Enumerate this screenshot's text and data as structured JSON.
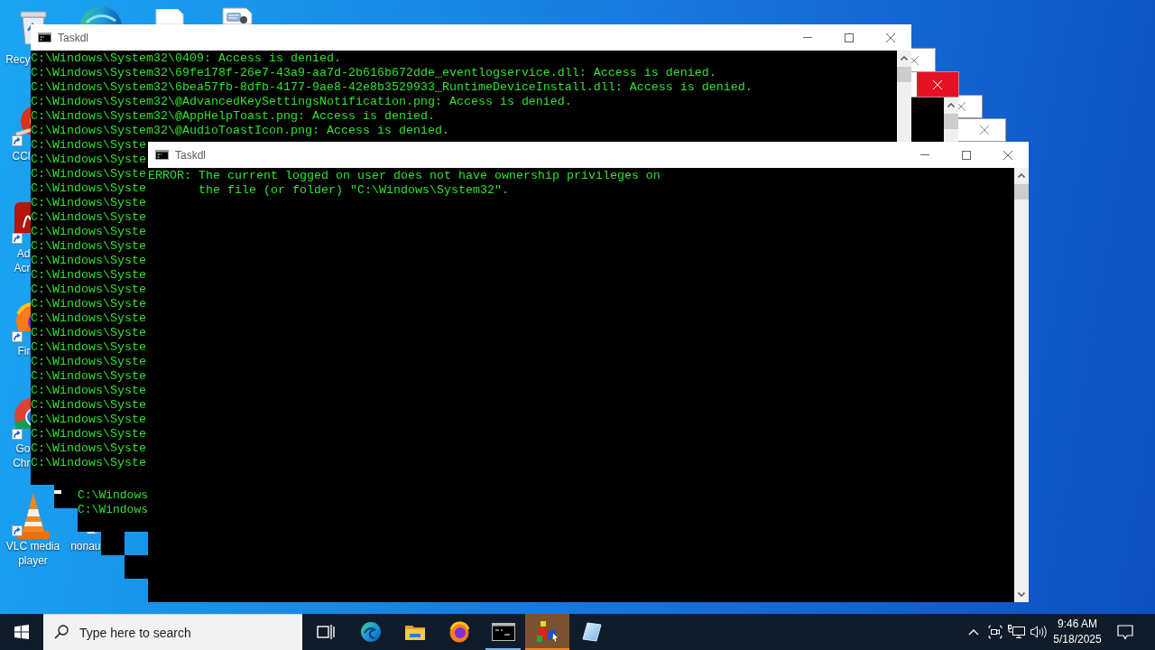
{
  "desktop_icons": [
    {
      "kind": "bin",
      "shortcut": false,
      "label_lines": [
        "Recy"
      ]
    },
    {
      "kind": "swirl"
    },
    {
      "kind": "page"
    },
    {
      "kind": "picture-page"
    },
    {
      "kind": "broom",
      "shortcut": true,
      "label_lines": [
        "CCl"
      ]
    },
    {
      "kind": "red-tile",
      "shortcut": true,
      "label_lines": [
        "Ad",
        "Acr"
      ]
    },
    {
      "kind": "fox",
      "shortcut": true,
      "label_lines": [
        "Fir"
      ]
    },
    {
      "kind": "ring",
      "shortcut": true,
      "label_lines": [
        "Go",
        "Chr"
      ]
    },
    {
      "kind": "cone",
      "shortcut": true,
      "label_lines": [
        "VLC media",
        "player"
      ]
    },
    {
      "kind": "page",
      "label_lines": [
        "nonau"
      ]
    }
  ],
  "hidden_windows": [
    {
      "close_hovered": false,
      "cursor": true
    },
    {
      "close_hovered": true,
      "cursor": false,
      "lines": [
        "C:\\Windows",
        "C:\\Windows"
      ]
    },
    {
      "close_hovered": false,
      "cursor": false
    },
    {
      "close_hovered": false,
      "cursor": false
    }
  ],
  "windows": [
    {
      "title": "Taskdl",
      "lines": [
        "C:\\Windows\\System32\\0409: Access is denied.",
        "C:\\Windows\\System32\\69fe178f-26e7-43a9-aa7d-2b616b672dde_eventlogservice.dll: Access is denied.",
        "C:\\Windows\\System32\\6bea57fb-8dfb-4177-9ae8-42e8b3529933_RuntimeDeviceInstall.dll: Access is denied.",
        "C:\\Windows\\System32\\@AdvancedKeySettingsNotification.png: Access is denied.",
        "C:\\Windows\\System32\\@AppHelpToast.png: Access is denied.",
        "C:\\Windows\\System32\\@AudioToastIcon.png: Access is denied.",
        "C:\\Windows\\Syste",
        "C:\\Windows\\Syste",
        "C:\\Windows\\Syste",
        "C:\\Windows\\Syste",
        "C:\\Windows\\Syste",
        "C:\\Windows\\Syste",
        "C:\\Windows\\Syste",
        "C:\\Windows\\Syste",
        "C:\\Windows\\Syste",
        "C:\\Windows\\Syste",
        "C:\\Windows\\Syste",
        "C:\\Windows\\Syste",
        "C:\\Windows\\Syste",
        "C:\\Windows\\Syste",
        "C:\\Windows\\Syste",
        "C:\\Windows\\Syste",
        "C:\\Windows\\Syste",
        "C:\\Windows\\Syste",
        "C:\\Windows\\Syste",
        "C:\\Windows\\Syste",
        "C:\\Windows\\Syste",
        "C:\\Windows\\Syste",
        "C:\\Windows\\Syste"
      ]
    },
    {
      "title": "Taskdl",
      "lines": [
        "ERROR: The current logged on user does not have ownership privileges on",
        "       the file (or folder) \"C:\\Windows\\System32\"."
      ]
    }
  ],
  "taskbar": {
    "search": {
      "placeholder": "Type here to search"
    },
    "apps": [
      {
        "kind": "swirl",
        "running": false,
        "attention": false
      },
      {
        "kind": "folder",
        "running": false,
        "attention": false
      },
      {
        "kind": "fox",
        "running": false,
        "attention": false
      },
      {
        "kind": "terminal",
        "running": true,
        "attention": false
      },
      {
        "kind": "cubes",
        "running": true,
        "attention": true
      },
      {
        "kind": "glass",
        "running": false,
        "attention": false
      }
    ],
    "clock": {
      "time": "9:46 AM",
      "date": "5/18/2025"
    }
  }
}
